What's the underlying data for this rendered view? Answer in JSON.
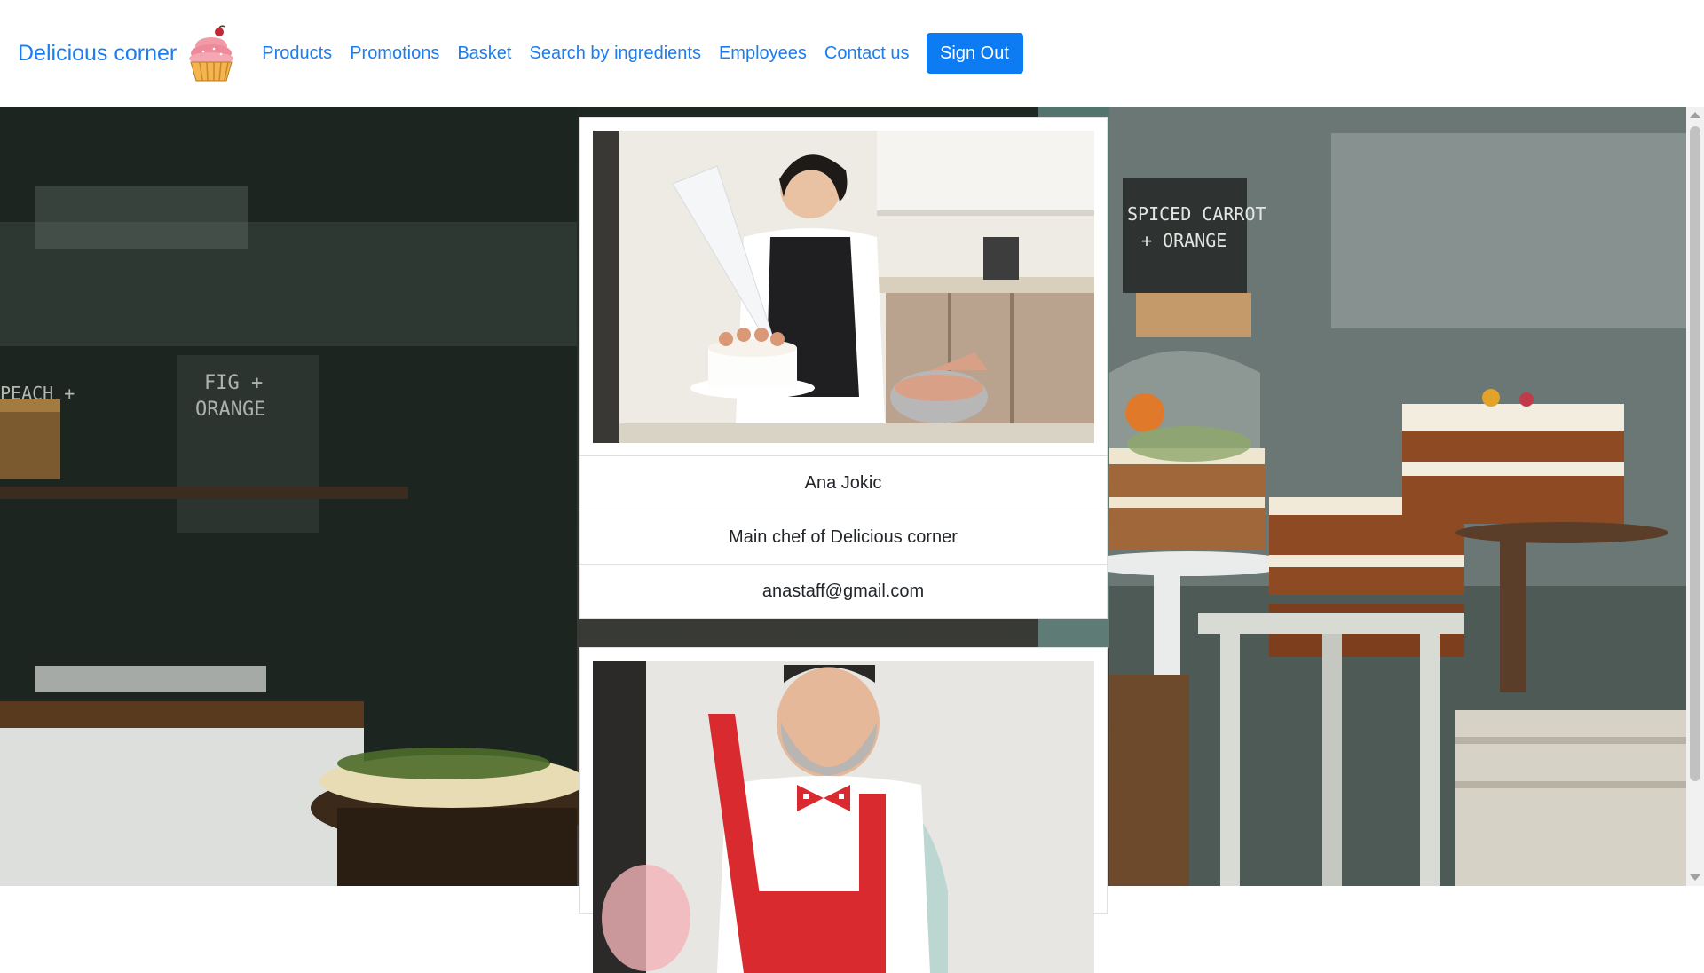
{
  "brand": {
    "name": "Delicious corner",
    "logo_icon": "cupcake-icon"
  },
  "nav": {
    "items": [
      {
        "label": "Products"
      },
      {
        "label": "Promotions"
      },
      {
        "label": "Basket"
      },
      {
        "label": "Search by ingredients"
      },
      {
        "label": "Employees"
      },
      {
        "label": "Contact us"
      }
    ],
    "sign_out_label": "Sign Out"
  },
  "background": {
    "chalkboard_left": [
      "PEACH +",
      "FIG +",
      "ORANGE"
    ],
    "chalkboard_right": [
      "SPICED CARROT",
      "+ ORANGE"
    ]
  },
  "employees": [
    {
      "name": "Ana Jokic",
      "title": "Main chef of Delicious corner",
      "email": "anastaff@gmail.com"
    }
  ],
  "colors": {
    "link": "#1a7ef0",
    "button": "#0d7cf2"
  }
}
